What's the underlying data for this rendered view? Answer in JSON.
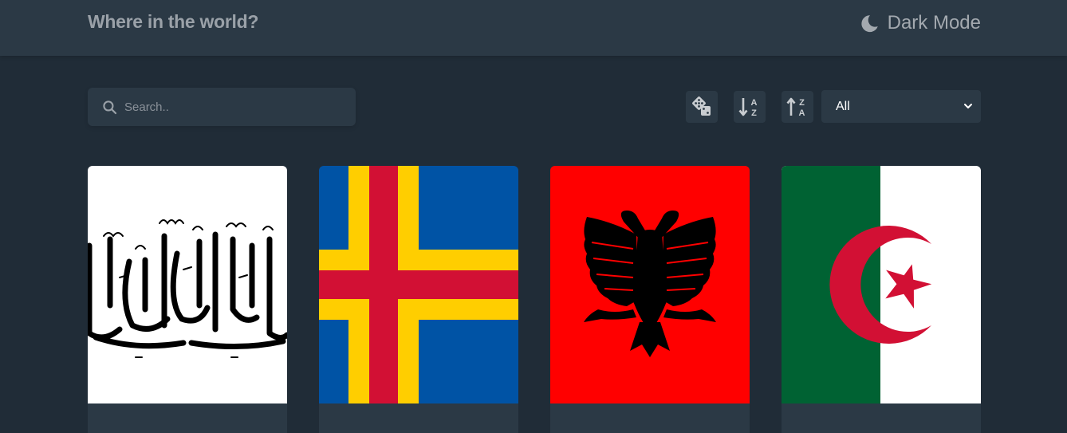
{
  "header": {
    "title": "Where in the world?",
    "mode_label": "Dark Mode",
    "mode_icon": "moon-icon"
  },
  "search": {
    "placeholder": "Search..",
    "value": "",
    "icon": "search-icon"
  },
  "toolbar": {
    "random_icon": "dice-icon",
    "sort_asc_icon": "sort-alpha-down-icon",
    "sort_desc_icon": "sort-alpha-up-icon",
    "region_selected": "All"
  },
  "colors": {
    "background": "#202c37",
    "element": "#2b3945",
    "text": "#ffffff"
  },
  "cards": [
    {
      "flag": "afghanistan-flag"
    },
    {
      "flag": "aland-islands-flag"
    },
    {
      "flag": "albania-flag"
    },
    {
      "flag": "algeria-flag"
    }
  ]
}
